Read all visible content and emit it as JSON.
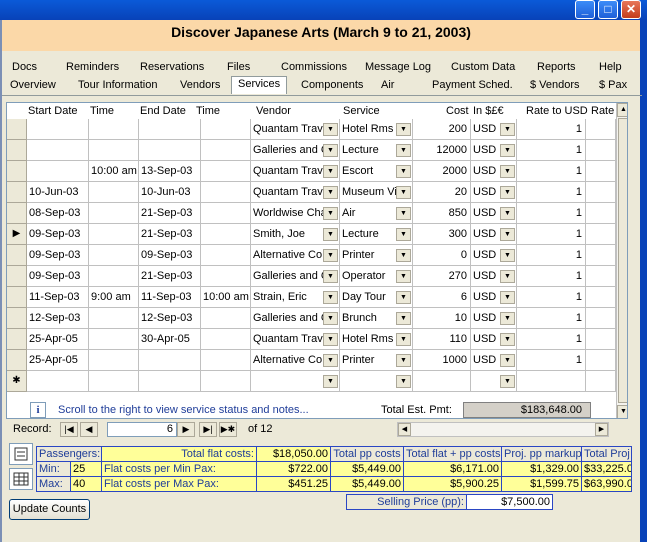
{
  "window": {
    "title": "Discover Japanese Arts (March 9 to 21, 2003)",
    "min": "_",
    "max": "□",
    "close": "✕"
  },
  "tabs_top": [
    "Docs",
    "Reminders",
    "Reservations",
    "Files",
    "Commissions",
    "Message Log",
    "Custom Data",
    "Reports",
    "Help"
  ],
  "tabs_bottom": [
    "Overview",
    "Tour Information",
    "Vendors",
    "Services",
    "Components",
    "Air",
    "Payment Sched.",
    "$ Vendors",
    "$ Pax"
  ],
  "columns": [
    "Start Date",
    "Time",
    "End Date",
    "Time",
    "Vendor",
    "Service",
    "Cost",
    "In $£€",
    "Rate to USD",
    "Rate"
  ],
  "rows": [
    [
      "",
      "",
      "",
      "",
      "Quantam Trave",
      "Hotel Rms",
      "200",
      "USD",
      "1",
      ""
    ],
    [
      "",
      "",
      "",
      "",
      "Galleries and G",
      "Lecture",
      "12000",
      "USD",
      "1",
      ""
    ],
    [
      "",
      "10:00 am",
      "13-Sep-03",
      "",
      "Quantam Trave",
      "Escort",
      "2000",
      "USD",
      "1",
      ""
    ],
    [
      "10-Jun-03",
      "",
      "10-Jun-03",
      "",
      "Quantam Trave",
      "Museum Vi",
      "20",
      "USD",
      "1",
      ""
    ],
    [
      "08-Sep-03",
      "",
      "21-Sep-03",
      "",
      "Worldwise Cha",
      "Air",
      "850",
      "USD",
      "1",
      ""
    ],
    [
      "09-Sep-03",
      "",
      "21-Sep-03",
      "",
      "Smith, Joe",
      "Lecture",
      "300",
      "USD",
      "1",
      ""
    ],
    [
      "09-Sep-03",
      "",
      "09-Sep-03",
      "",
      "Alternative Co",
      "Printer",
      "0",
      "USD",
      "1",
      ""
    ],
    [
      "09-Sep-03",
      "",
      "21-Sep-03",
      "",
      "Galleries and G",
      "Operator",
      "270",
      "USD",
      "1",
      ""
    ],
    [
      "11-Sep-03",
      "9:00 am",
      "11-Sep-03",
      "10:00 am",
      "Strain, Eric",
      "Day Tour",
      "6",
      "USD",
      "1",
      ""
    ],
    [
      "12-Sep-03",
      "",
      "12-Sep-03",
      "",
      "Galleries and G",
      "Brunch",
      "10",
      "USD",
      "1",
      ""
    ],
    [
      "25-Apr-05",
      "",
      "30-Apr-05",
      "",
      "Quantam Trave",
      "Hotel Rms",
      "110",
      "USD",
      "1",
      ""
    ],
    [
      "25-Apr-05",
      "",
      "",
      "",
      "Alternative Co",
      "Printer",
      "1000",
      "USD",
      "1",
      ""
    ]
  ],
  "new_row_marker": "✱",
  "current_marker": "▶",
  "info": {
    "icon": "i",
    "text": "Scroll to the right to view service status and notes...",
    "est_label": "Total Est. Pmt:",
    "est_value": "$183,648.00"
  },
  "record": {
    "label": "Record:",
    "current": "6",
    "of": "of  12"
  },
  "summary": {
    "passengers": "Passengers:",
    "min": "Min:",
    "min_val": "25",
    "max": "Max:",
    "max_val": "40",
    "total_flat_label": "Total flat costs:",
    "total_flat": "$18,050.00",
    "flat_min_label": "Flat costs per Min Pax:",
    "flat_min": "$722.00",
    "flat_max_label": "Flat costs per Max Pax:",
    "flat_max": "$451.25",
    "pp_label": "Total pp costs",
    "pp_min": "$5,449.00",
    "pp_max": "$5,449.00",
    "flatpp_label": "Total flat + pp costs",
    "flatpp_min": "$6,171.00",
    "flatpp_max": "$5,900.25",
    "markup_label": "Proj. pp markup",
    "markup_min": "$1,329.00",
    "markup_max": "$1,599.75",
    "profit_label": "Total Proj Profit",
    "profit_min": "$33,225.00",
    "profit_max": "$63,990.00",
    "selling_label": "Selling Price (pp):",
    "selling": "$7,500.00"
  },
  "update_button": "Update Counts"
}
